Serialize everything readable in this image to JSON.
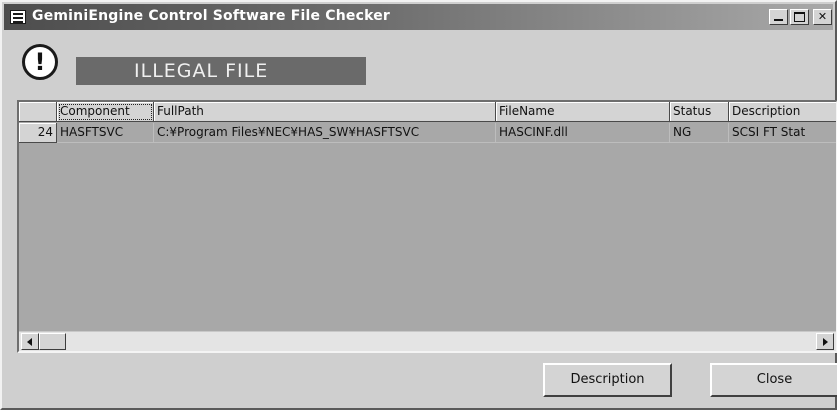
{
  "window": {
    "title": "GeminiEngine Control Software File Checker",
    "controls": {
      "minimize_icon": "minimize-icon",
      "maximize_icon": "maximize-icon",
      "close_glyph": "✕"
    }
  },
  "banner": {
    "icon_glyph": "!",
    "text": "ILLEGAL FILE"
  },
  "table": {
    "columns": [
      "",
      "Component",
      "FullPath",
      "FileName",
      "Status",
      "Description"
    ],
    "rows": [
      {
        "row_number": "24",
        "component": "HASFTSVC",
        "full_path": "C:¥Program Files¥NEC¥HAS_SW¥HASFTSVC",
        "file_name": "HASCINF.dll",
        "status": "NG",
        "description": "SCSI FT Stat"
      }
    ]
  },
  "buttons": {
    "description": "Description",
    "close": "Close"
  },
  "colors": {
    "titlebar_start": "#4d4d4d",
    "titlebar_end": "#a9a9a9",
    "banner_bg": "#6a6a6a",
    "grid_empty_bg": "#a8a8a8",
    "face": "#cfcfcf"
  }
}
